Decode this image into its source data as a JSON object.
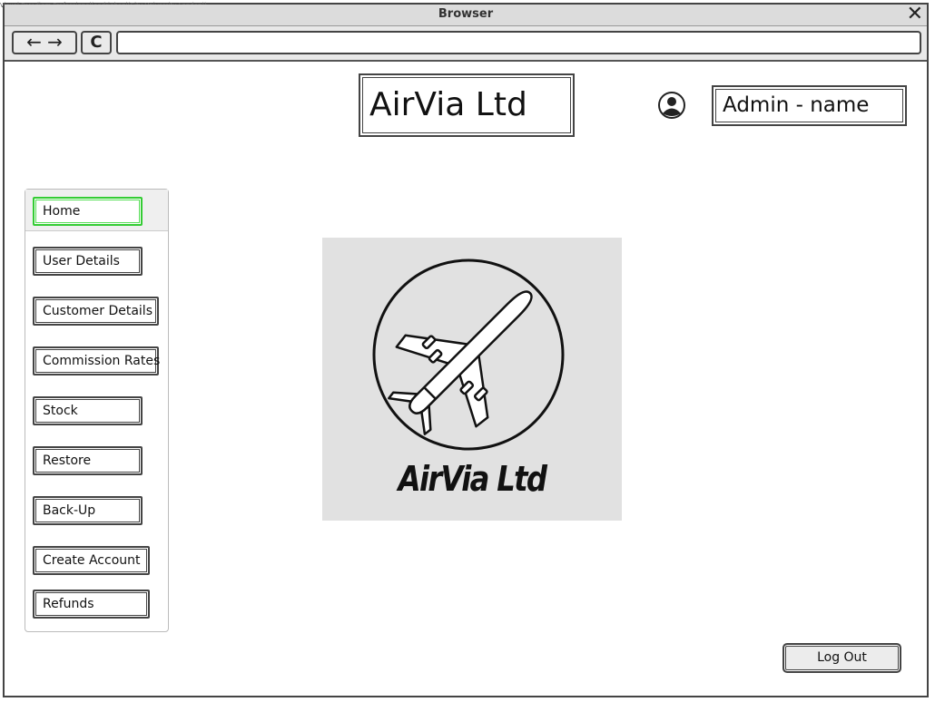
{
  "watermark": "Visual Paradigm Professional(aadrighani(City University London))",
  "browser": {
    "title": "Browser",
    "close_icon": "close-icon",
    "back_forward_glyph": "← →",
    "refresh_glyph": "C",
    "address": ""
  },
  "header": {
    "company_title": "AirVia Ltd",
    "user_icon": "user-avatar-icon",
    "admin_label": "Admin - name"
  },
  "sidebar": {
    "items": [
      {
        "label": "Home",
        "active": true
      },
      {
        "label": "User Details"
      },
      {
        "label": "Customer Details"
      },
      {
        "label": "Commission Rates"
      },
      {
        "label": "Stock"
      },
      {
        "label": "Restore"
      },
      {
        "label": "Back-Up"
      },
      {
        "label": "Create Account"
      },
      {
        "label": "Refunds"
      }
    ]
  },
  "main": {
    "logo_icon": "airplane-icon",
    "logo_text": "AirVia Ltd"
  },
  "footer": {
    "logout_label": "Log Out"
  }
}
